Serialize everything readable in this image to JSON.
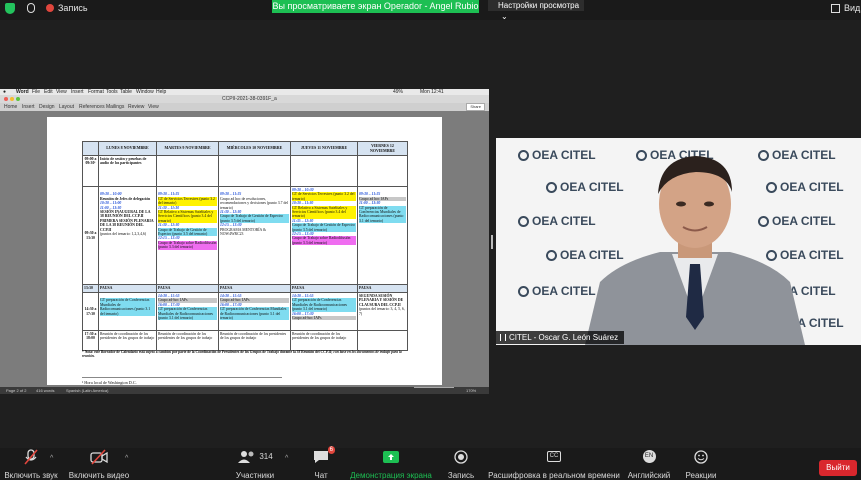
{
  "topbar": {
    "record_label": "Запись",
    "banner": "Вы просматриваете экран Operador - Angel Rubio",
    "view_options": "Настройки просмотра",
    "view_label": "Вид"
  },
  "word": {
    "menu": [
      "Word",
      "File",
      "Edit",
      "View",
      "Insert",
      "Format",
      "Tools",
      "Table",
      "Window",
      "Help"
    ],
    "clock": "Mon 12:41",
    "battery": "49%",
    "filename": "CCPII-2021-38-0391F_a",
    "ribbon_tabs": [
      "Home",
      "Insert",
      "Design",
      "Layout",
      "References",
      "Mailings",
      "Review",
      "View"
    ],
    "share": "Share",
    "status_page": "Page 2 of 2",
    "status_words": "416 words",
    "status_lang": "Spanish (Latin America)",
    "zoom": "170%"
  },
  "schedule": {
    "headers": [
      "",
      "LUNES 8 NOVIEMBRE",
      "MARTES 9 NOVIEMBRE",
      "MIÉRCOLES 10 NOVIEMBRE",
      "JUEVES 11 NOVIEMBRE",
      "VIERNES 12 NOVIEMBRE"
    ],
    "r1_time": "09:00 a 09:30¹",
    "r1_mon": "Inicio de sesión y pruebas de audio de los participantes",
    "r2_time": "09:30 a 13:30",
    "mon_t1": "09:30 – 10:00",
    "mon_l1": "Reunión de Jefes de delegación",
    "mon_t2": "10:30 – 11:00",
    "mon_t3": "11:00 – 13:30",
    "mon_l2": "SESIÓN INAUGURAL DE LA 38 REUNIÓN DEL CCP.II",
    "mon_l3": "PRIMERA SESIÓN PLENARIA DE LA 38 REUNIÓN DEL CCP.II",
    "mon_l4": "(puntos del temario: 1,2,3,4,6)",
    "tue_t1": "09:30 – 11:25",
    "tue_l1": "GT de Servicios Terrestres (punto 3.2 del temario)",
    "tue_t2": "11:30 – 11:30",
    "tue_l2": "GT Relativo a Sistemas Satelitales y Servicios Científicos (punto 3.4 del temario)",
    "tue_t3": "11:30 – 12:30",
    "tue_l3": "Grupo de Trabajo de Gestión de Espectro (punto 3.5 del temario)",
    "tue_t4": "12:15 – 13:30",
    "tue_l4": "Grupo de Trabajo sobre Radiodifusión (punto 3.3 del temario)",
    "wed_t1": "09:30 – 11:25",
    "wed_l1": "Grupo ad hoc de resoluciones, recomendaciones y decisiones (punto 3.7 del temario)",
    "wed_t2": "11:30 – 12:30",
    "wed_l2": "Grupo de Trabajo de Gestión de Espectro (punto 3.5 del temario)",
    "wed_t3": "12:15 – 13:30",
    "wed_l3": "PROGRAMA MENTORÍA & NOW4WRC23",
    "thu_t1": "09:30 – 10:30",
    "thu_l1": "GT de Servicios Terrestres (punto 3.2 del temario)",
    "thu_t2": "10:30 – 11:30",
    "thu_l2": "GT Relativo a Sistemas Satelitales y Servicios Científicos (punto 3.4 del temario)",
    "thu_t3": "11:35 – 12:30",
    "thu_l3": "Grupo de Trabajo de Gestión de Espectro (punto 3.5 del temario)",
    "thu_t4": "12:15 – 13:30",
    "thu_l4": "Grupo de Trabajo sobre Radiodifusión (punto 3.3 del temario)",
    "fri_t1": "09:30 – 11:25",
    "fri_l1": "Grupo ad hoc IAPs",
    "fri_t2": "11:00 – 13:30",
    "fri_l2": "GT preparación de Conferencias Mundiales de Radiocomunicaciones (punto 3.1 del temario)",
    "pausa_time": "13:30",
    "pausa": "PAUSA",
    "r3_time": "14:30 a 17:30",
    "mon_p1": "GT preparación de Conferencias Mundiales de Radiocomunicaciones (punto 3.1 del temario)",
    "tue_p_t1": "14:30 – 15:55",
    "tue_p1": "Grupo ad-hoc IAPs",
    "tue_p_t2": "16:00 – 17:30",
    "tue_p2": "GT preparación de Conferencias Mundiales de Radiocomunicaciones (punto 3.1 del temario)",
    "wed_p_t1": "14:30 – 15:55",
    "wed_p1": "Grupo ad-hoc IAPs",
    "wed_p_t2": "16:00 – 17:30",
    "wed_p2": "GT preparación de Conferencias Mundiales de Radiocomunicaciones (punto 3.1 del temario)",
    "thu_p_t1": "14:30 – 15:55",
    "thu_p1": "GT preparación de Conferencias Mundiales de Radiocomunicaciones (punto 3.1 del temario)",
    "thu_p_t2": "16:00 – 17:30",
    "thu_p2": "Grupo ad-hoc IAPs",
    "fri_p1": "SEGUNDA SESIÓN PLENARIA Y SESIÓN DE CLAUSURA DEL CCP.II",
    "fri_p2": "(puntos del temario: 3, 4, 5, 6, 7)",
    "r4_time": "17:30 a 18:00",
    "coord": "Reunión de coordinación de los presidentes de los grupos de trabajo",
    "note_a": "* Nota: este Borrador de Calendario está sujeto a cambios por parte de la Coordinación de Presidentes de los Grupos de Trabajo durante la 38 Reunión del CCP.II;",
    "note_b": "con base en los documentos de trabajo para la reunión.",
    "footnote": "¹ Hora local de Washington D.C."
  },
  "video": {
    "watermark": "OEA CITEL",
    "participant": "CITEL - Oscar G. León Suárez"
  },
  "toolbar": {
    "mic": "Включить звук",
    "video": "Включить видео",
    "participants": "Участники",
    "participants_count": "314",
    "chat": "Чат",
    "chat_badge": "6",
    "share": "Демонстрация экрана",
    "record": "Запись",
    "captions": "Расшифровка в реальном времени",
    "captions_badge": "CC",
    "language": "Английский",
    "language_badge": "EN",
    "reactions": "Реакции",
    "leave": "Выйти"
  },
  "colors": {
    "zoom_green": "#1dbf53",
    "leave_red": "#d9272d",
    "highlight_yellow": "#fff200",
    "highlight_cyan": "#7fdcf0",
    "highlight_magenta": "#ef6df0",
    "header_blue": "#d6e3f1"
  }
}
